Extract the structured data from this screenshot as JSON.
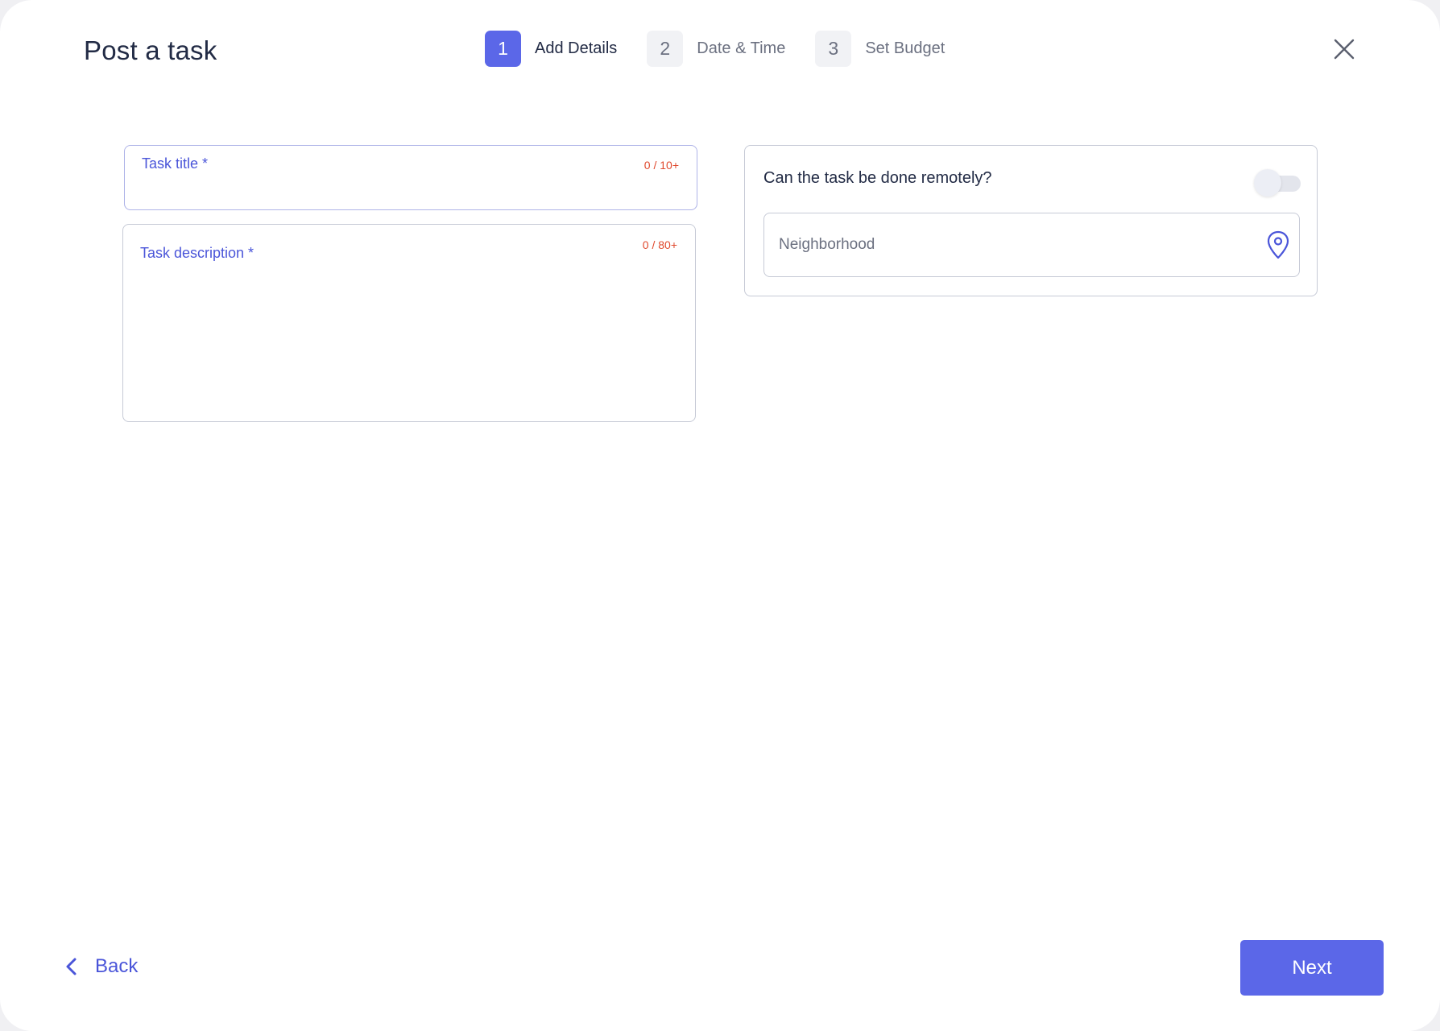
{
  "header": {
    "title": "Post a task",
    "close_icon": "close-icon"
  },
  "stepper": {
    "steps": [
      {
        "number": "1",
        "label": "Add Details",
        "state": "active"
      },
      {
        "number": "2",
        "label": "Date & Time",
        "state": "inactive"
      },
      {
        "number": "3",
        "label": "Set Budget",
        "state": "inactive"
      }
    ],
    "active_color": "#5b67e8"
  },
  "form": {
    "task_title": {
      "label": "Task title *",
      "counter": "0 / 10+",
      "value": ""
    },
    "task_description": {
      "label": "Task description  *",
      "counter": "0 / 80+",
      "value": ""
    },
    "remote": {
      "question": "Can the task be done remotely?",
      "toggle_on": false
    },
    "neighborhood": {
      "placeholder": "Neighborhood",
      "value": "",
      "icon": "location-pin-icon"
    }
  },
  "footer": {
    "back_label": "Back",
    "next_label": "Next"
  },
  "colors": {
    "accent": "#5b67e8",
    "label_blue": "#4a55d9",
    "counter_red": "#e04a2e"
  }
}
